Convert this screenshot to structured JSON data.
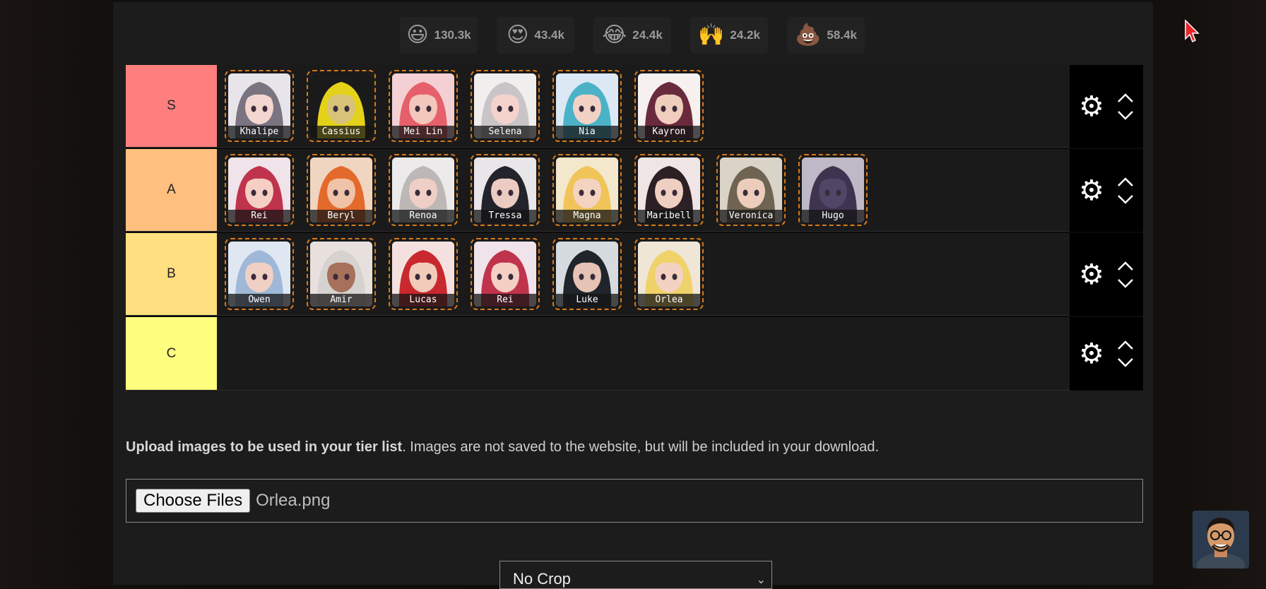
{
  "reactions": [
    {
      "emoji": "😃",
      "icon": "smiley-icon",
      "count": "130.3k"
    },
    {
      "emoji": "😍",
      "icon": "heart-eyes-icon",
      "count": "43.4k"
    },
    {
      "emoji": "😂",
      "icon": "laughing-icon",
      "count": "24.4k"
    },
    {
      "emoji": "🙌",
      "icon": "raised-hands-icon",
      "count": "24.2k"
    },
    {
      "emoji": "💩",
      "icon": "poop-icon",
      "count": "58.4k"
    }
  ],
  "tiers": [
    {
      "label": "S",
      "color": "#ff7f7f",
      "items": [
        "Khalipe",
        "Cassius",
        "Mei Lin",
        "Selena",
        "Nia",
        "Kayron"
      ]
    },
    {
      "label": "A",
      "color": "#ffbf7f",
      "items": [
        "Rei",
        "Beryl",
        "Renoa",
        "Tressa",
        "Magna",
        "Maribell",
        "Veronica",
        "Hugo"
      ]
    },
    {
      "label": "B",
      "color": "#ffdf7f",
      "items": [
        "Owen",
        "Amir",
        "Lucas",
        "Rei",
        "Luke",
        "Orlea"
      ]
    },
    {
      "label": "C",
      "color": "#ffff7f",
      "items": []
    }
  ],
  "upload": {
    "bold_text": "Upload images to be used in your tier list",
    "rest_text": ". Images are not saved to the website, but will be included in your download.",
    "button_label": "Choose Files",
    "file_name": "Orlea.png"
  },
  "crop": {
    "selected": "No Crop"
  },
  "colors": {
    "accent_border": "#d97a1c",
    "panel_bg": "#1c1c1c"
  }
}
